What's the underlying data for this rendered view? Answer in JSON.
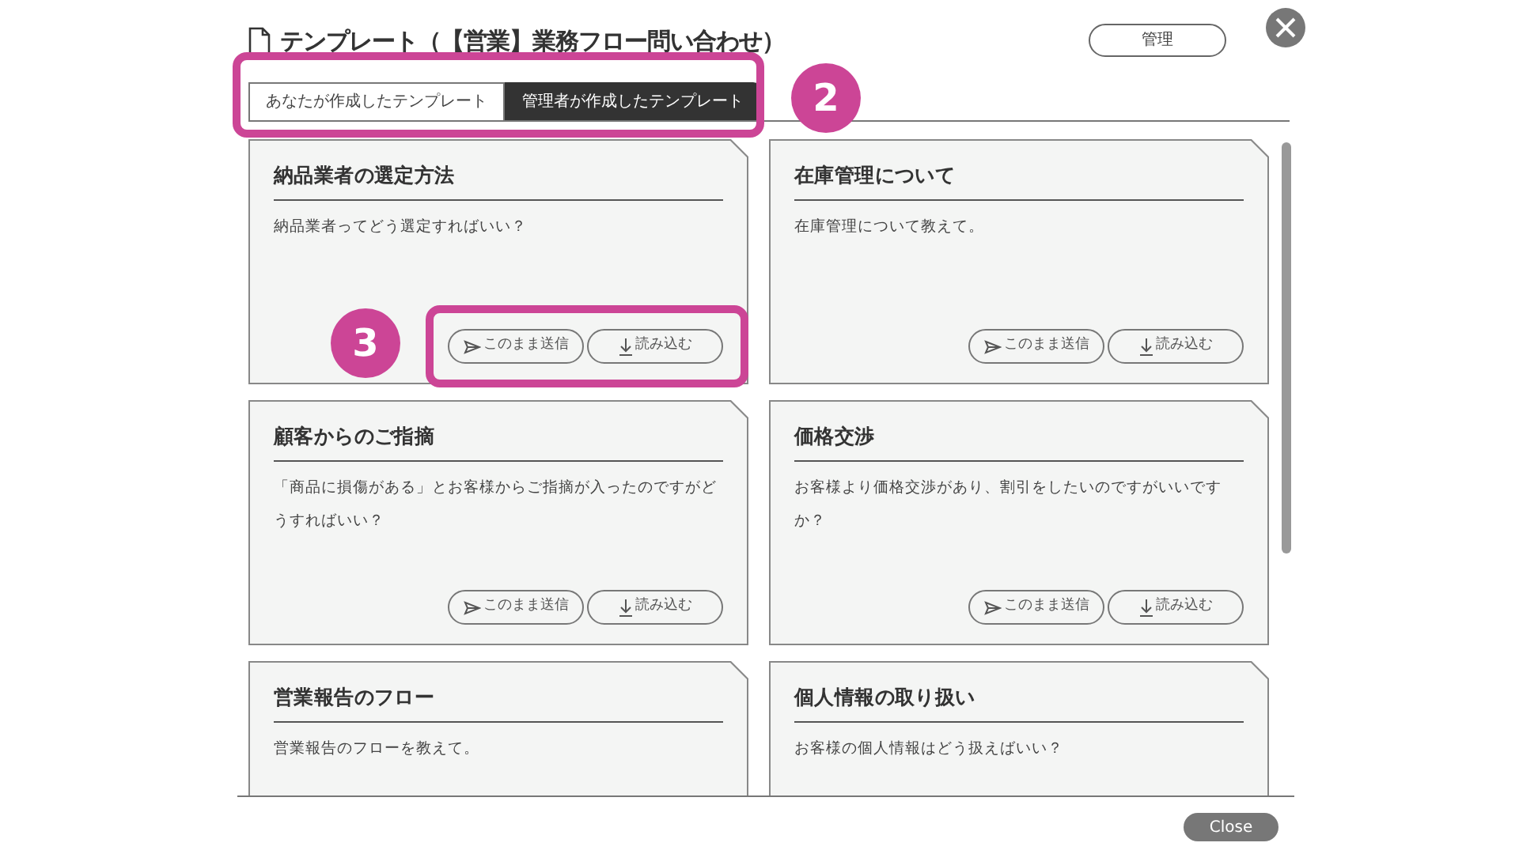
{
  "dialog": {
    "title": "テンプレート（【営業】業務フロー問い合わせ）",
    "manage_button": "管理",
    "close_button": "Close"
  },
  "tabs": [
    {
      "label": "あなたが作成したテンプレート",
      "selected": false
    },
    {
      "label": "管理者が作成したテンプレート",
      "selected": true
    }
  ],
  "templates": [
    {
      "title": "納品業者の選定方法",
      "body": "納品業者ってどう選定すればいい？",
      "actions": [
        {
          "kind": "send",
          "label": "このまま送信"
        },
        {
          "kind": "load",
          "label": "読み込む"
        }
      ]
    },
    {
      "title": "在庫管理について",
      "body": "在庫管理について教えて。",
      "actions": [
        {
          "kind": "send",
          "label": "このまま送信"
        },
        {
          "kind": "load",
          "label": "読み込む"
        }
      ]
    },
    {
      "title": "顧客からのご指摘",
      "body": "「商品に損傷がある」とお客様からご指摘が入ったのですがどうすればいい？",
      "actions": [
        {
          "kind": "send",
          "label": "このまま送信"
        },
        {
          "kind": "load",
          "label": "読み込む"
        }
      ]
    },
    {
      "title": "価格交渉",
      "body": "お客様より価格交渉があり、割引をしたいのですがいいですか？",
      "actions": [
        {
          "kind": "send",
          "label": "このまま送信"
        },
        {
          "kind": "load",
          "label": "読み込む"
        }
      ]
    },
    {
      "title": "営業報告のフロー",
      "body": "営業報告のフローを教えて。"
    },
    {
      "title": "個人情報の取り扱い",
      "body": "お客様の個人情報はどう扱えばいい？"
    }
  ],
  "annotations": [
    {
      "kind": "tabs",
      "label": "2"
    },
    {
      "kind": "actions",
      "label": "3"
    }
  ]
}
